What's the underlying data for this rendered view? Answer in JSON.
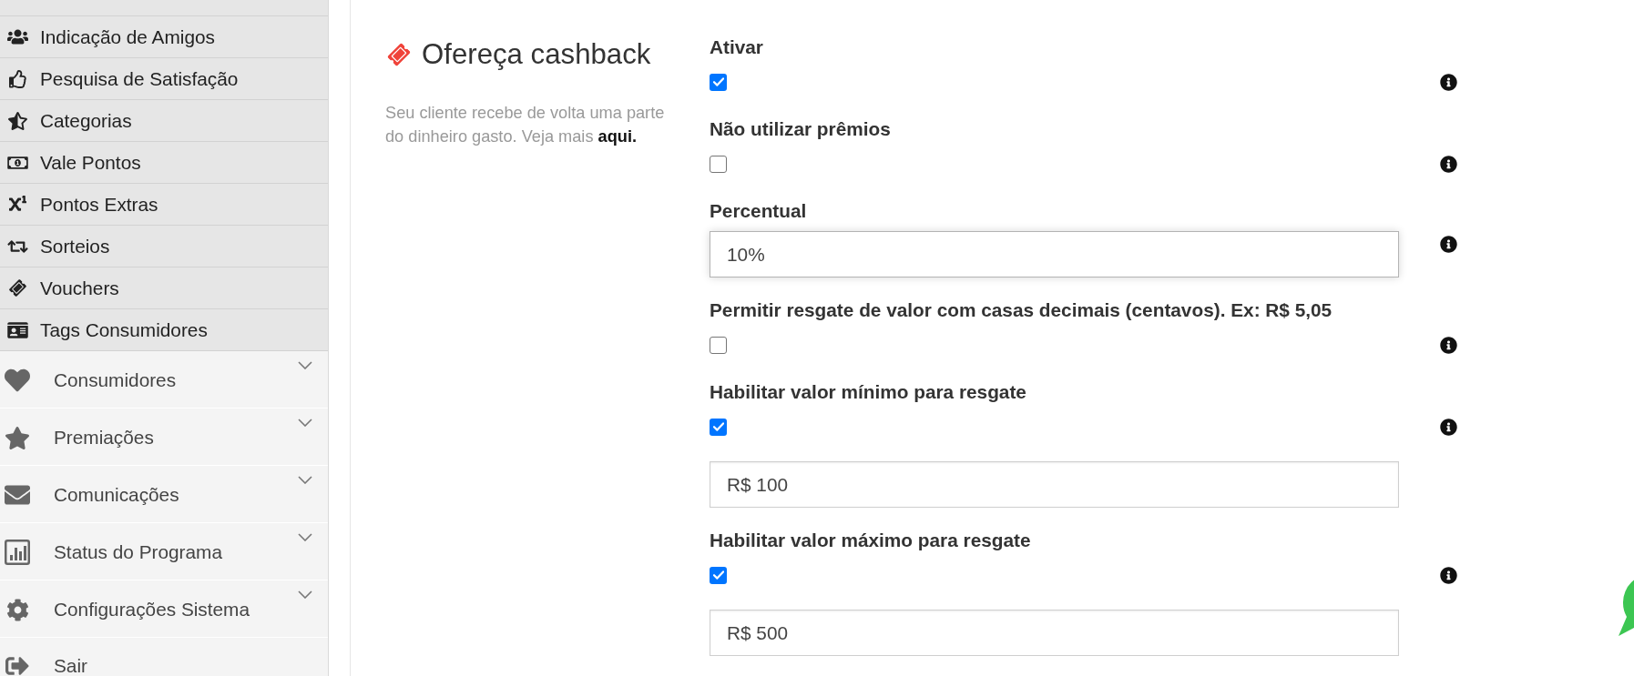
{
  "sidebar": {
    "submenu_items": [
      "Indicação de Amigos",
      "Pesquisa de Satisfação",
      "Categorias",
      "Vale Pontos",
      "Pontos Extras",
      "Sorteios",
      "Vouchers",
      "Tags Consumidores"
    ],
    "menu_items": [
      {
        "label": "Consumidores",
        "kind": "group",
        "expanded": false
      },
      {
        "label": "Premiações",
        "kind": "group",
        "expanded": false
      },
      {
        "label": "Comunicações",
        "kind": "group",
        "expanded": false
      },
      {
        "label": "Status do Programa",
        "kind": "group",
        "expanded": false
      },
      {
        "label": "Configurações Sistema",
        "kind": "group",
        "expanded": false
      },
      {
        "label": "Sair",
        "kind": "link"
      }
    ]
  },
  "section": {
    "title": "Ofereça cashback",
    "description": "Seu cliente recebe de volta uma parte do dinheiro gasto. Veja mais",
    "link": "aqui."
  },
  "form": {
    "fields": [
      {
        "kind": "checkbox",
        "label": "Ativar",
        "checked": true
      },
      {
        "kind": "checkbox",
        "label": "Não utilizar prêmios",
        "checked": false
      },
      {
        "kind": "input",
        "label": "Percentual",
        "value": "10%",
        "focused": true
      },
      {
        "kind": "checkbox",
        "label": "Permitir resgate de valor com casas decimais (centavos). Ex: R$ 5,05",
        "checked": false
      },
      {
        "kind": "amount",
        "label": "Habilitar valor mínimo para resgate",
        "checked": true,
        "value": "R$ 100",
        "focused": false
      },
      {
        "kind": "amount",
        "label": "Habilitar valor máximo para resgate",
        "checked": true,
        "value": "R$ 500",
        "focused": false
      }
    ]
  }
}
